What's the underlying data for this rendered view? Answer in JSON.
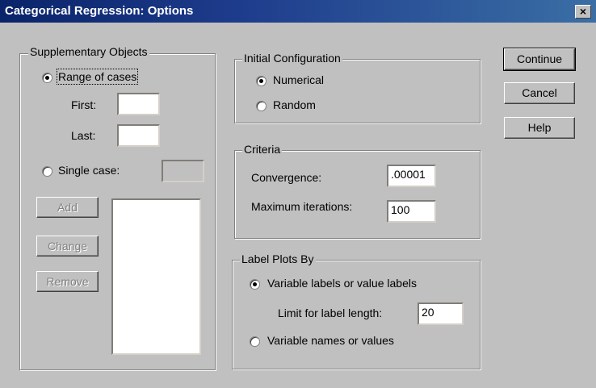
{
  "window": {
    "title": "Categorical Regression: Options",
    "close_symbol": "×"
  },
  "supplementary": {
    "legend": "Supplementary Objects",
    "range_label": "Range of cases",
    "first_label": "First:",
    "first_value": "",
    "last_label": "Last:",
    "last_value": "",
    "single_label": "Single case:",
    "single_value": "",
    "add_label": "Add",
    "change_label": "Change",
    "remove_label": "Remove",
    "selected": "range"
  },
  "initial_config": {
    "legend": "Initial Configuration",
    "numerical_label": "Numerical",
    "random_label": "Random",
    "selected": "numerical"
  },
  "criteria": {
    "legend": "Criteria",
    "convergence_label": "Convergence:",
    "convergence_value": ".00001",
    "max_iter_label": "Maximum iterations:",
    "max_iter_value": "100"
  },
  "label_plots": {
    "legend": "Label Plots By",
    "variable_labels_label": "Variable labels or value labels",
    "limit_label": "Limit for label length:",
    "limit_value": "20",
    "variable_names_label": "Variable names or values",
    "selected": "labels"
  },
  "buttons": {
    "continue": "Continue",
    "cancel": "Cancel",
    "help": "Help"
  }
}
